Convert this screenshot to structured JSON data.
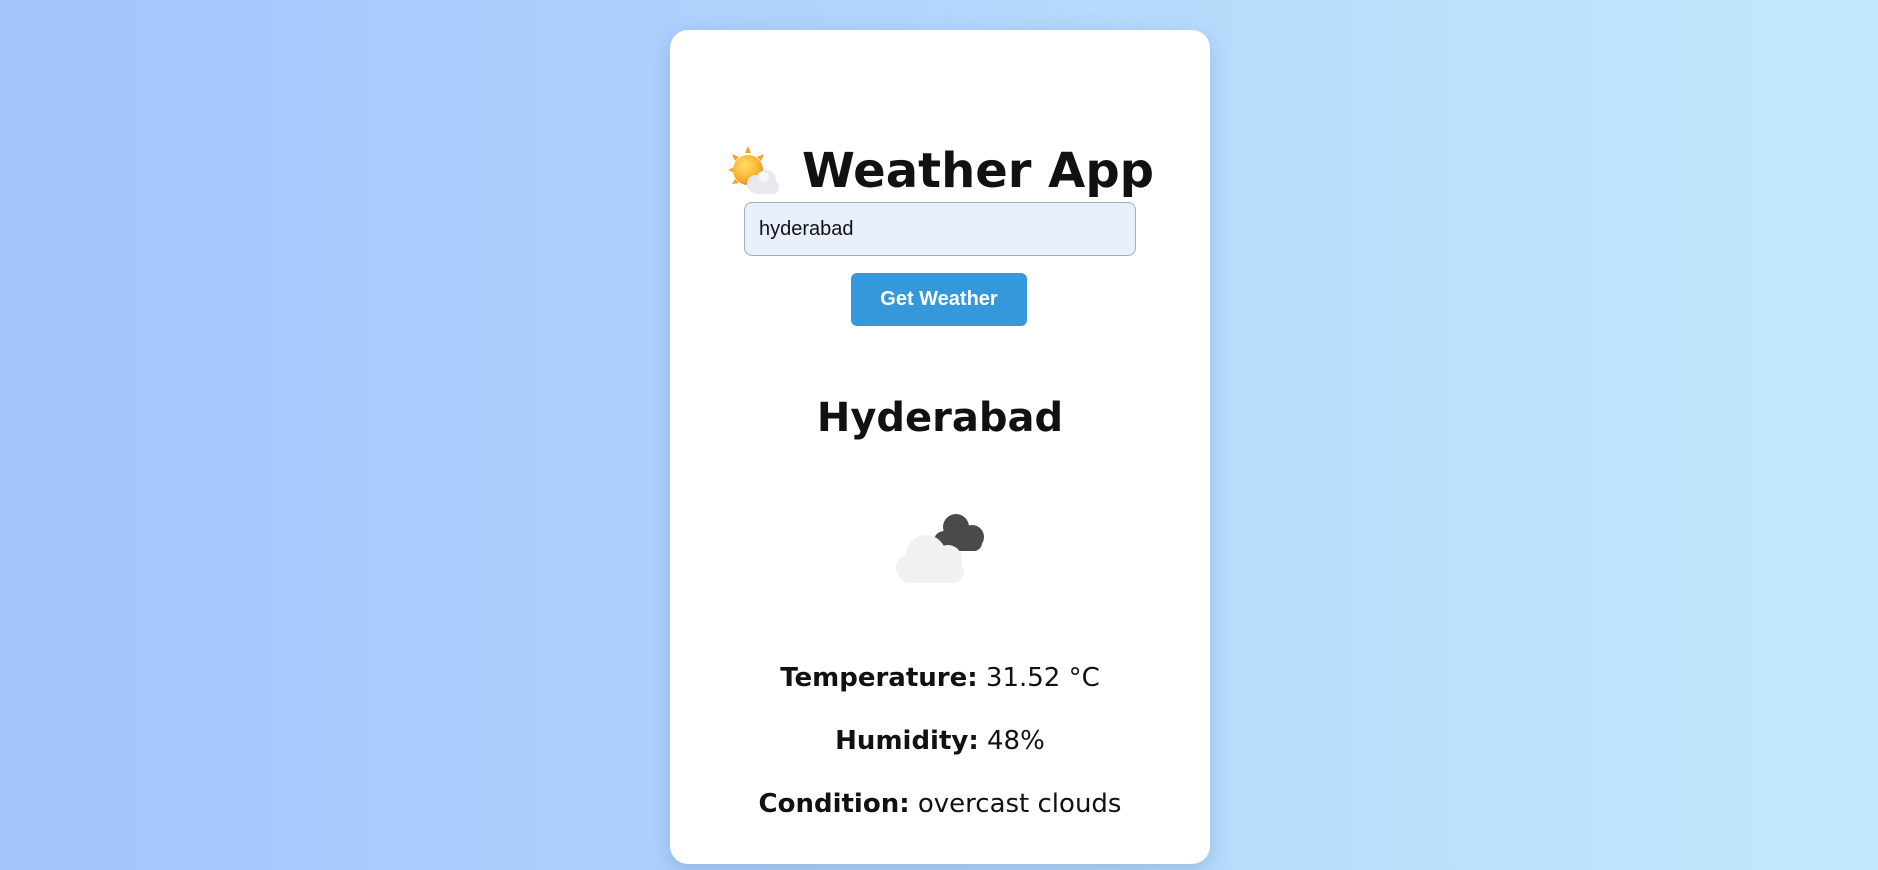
{
  "app": {
    "title": "Weather App",
    "title_icon": "sun-behind-cloud-icon"
  },
  "search": {
    "value": "hyderabad",
    "button_label": "Get Weather"
  },
  "result": {
    "city": "Hyderabad",
    "icon": "overcast-clouds-icon",
    "temperature_label": "Temperature:",
    "temperature_value": "31.52 °C",
    "humidity_label": "Humidity:",
    "humidity_value": "48%",
    "condition_label": "Condition:",
    "condition_value": "overcast clouds"
  },
  "colors": {
    "background_start": "#a1c4fd",
    "background_end": "#c2e9fb",
    "button": "#3498db",
    "input_bg": "#e8f0fe"
  }
}
